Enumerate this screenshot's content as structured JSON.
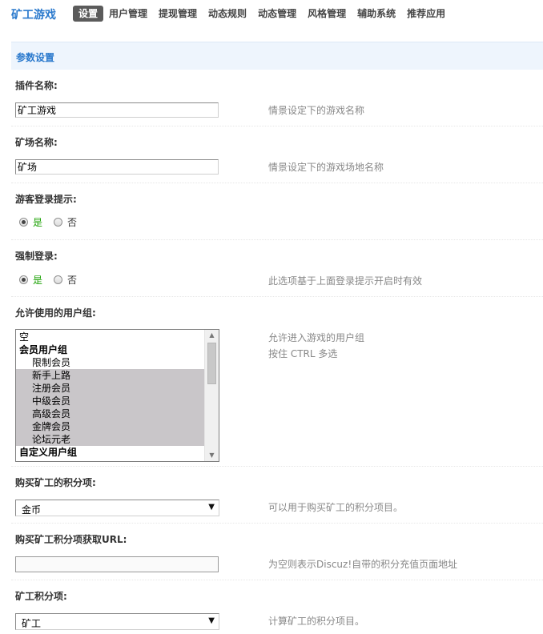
{
  "brand": "矿工游戏",
  "nav": [
    "设置",
    "用户管理",
    "提现管理",
    "动态规则",
    "动态管理",
    "风格管理",
    "辅助系统",
    "推荐应用"
  ],
  "section_title": "参数设置",
  "fields": {
    "plugin_name": {
      "label": "插件名称:",
      "value": "矿工游戏",
      "tip": "情景设定下的游戏名称"
    },
    "mine_name": {
      "label": "矿场名称:",
      "value": "矿场",
      "tip": "情景设定下的游戏场地名称"
    },
    "guest_login_tip": {
      "label": "游客登录提示:",
      "yes": "是",
      "no": "否",
      "selected": "是"
    },
    "force_login": {
      "label": "强制登录:",
      "yes": "是",
      "no": "否",
      "selected": "是",
      "tip": "此选项基于上面登录提示开启时有效"
    },
    "allowed_groups": {
      "label": "允许使用的用户组:",
      "tip1": "允许进入游戏的用户组",
      "tip2": "按住 CTRL 多选",
      "options": [
        "空",
        "会员用户组",
        "限制会员",
        "新手上路",
        "注册会员",
        "中级会员",
        "高级会员",
        "金牌会员",
        "论坛元老",
        "自定义用户组"
      ]
    },
    "buy_credit": {
      "label": "购买矿工的积分项:",
      "value": "金币",
      "tip": "可以用于购买矿工的积分项目。"
    },
    "buy_credit_url": {
      "label": "购买矿工积分项获取URL:",
      "value": "",
      "tip": "为空则表示Discuz!自带的积分充值页面地址"
    },
    "miner_credit": {
      "label": "矿工积分项:",
      "value": "矿工",
      "tip": "计算矿工的积分项目。"
    }
  },
  "icons": {
    "dropdown": "chevron-down-icon",
    "scroll_up": "scroll-up-icon",
    "scroll_down": "scroll-down-icon"
  }
}
